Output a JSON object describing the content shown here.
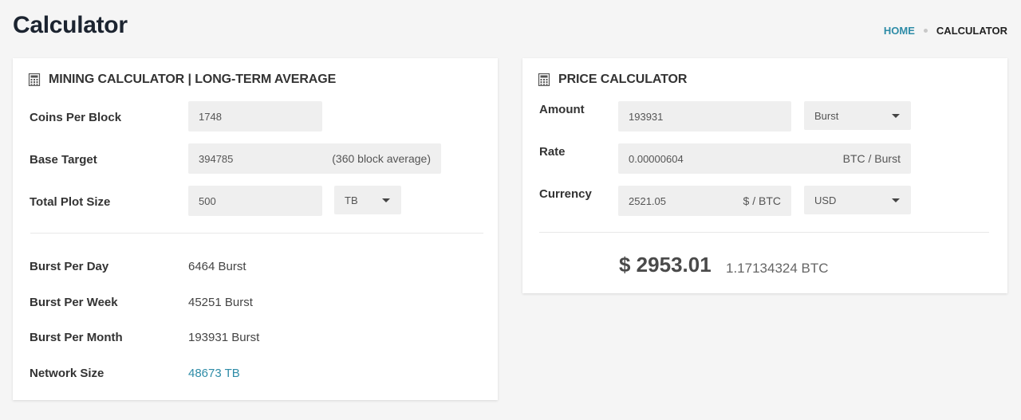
{
  "page": {
    "title": "Calculator"
  },
  "breadcrumb": {
    "home": "HOME",
    "current": "CALCULATOR"
  },
  "mining": {
    "title": "MINING CALCULATOR | LONG-TERM AVERAGE",
    "icon": "calculator-icon",
    "coins_per_block_label": "Coins Per Block",
    "coins_per_block_value": "1748",
    "base_target_label": "Base Target",
    "base_target_value": "394785",
    "base_target_suffix": "(360 block average)",
    "plot_size_label": "Total Plot Size",
    "plot_size_value": "500",
    "plot_unit": "TB",
    "burst_day_label": "Burst Per Day",
    "burst_day_value": "6464 Burst",
    "burst_week_label": "Burst Per Week",
    "burst_week_value": "45251 Burst",
    "burst_month_label": "Burst Per Month",
    "burst_month_value": "193931 Burst",
    "network_size_label": "Network Size",
    "network_size_value": "48673 TB"
  },
  "price": {
    "title": "PRICE CALCULATOR",
    "icon": "calculator-icon",
    "amount_label": "Amount",
    "amount_value": "193931",
    "amount_unit": "Burst",
    "rate_label": "Rate",
    "rate_value": "0.00000604",
    "rate_suffix": "BTC / Burst",
    "currency_label": "Currency",
    "currency_value": "2521.05",
    "currency_suffix": "$ / BTC",
    "currency_unit": "USD",
    "total_usd": "$ 2953.01",
    "total_btc": "1.17134324 BTC"
  },
  "colors": {
    "accent": "#2e8ca7",
    "background": "#f5f5f5",
    "panel": "#ffffff",
    "input": "#efefef"
  }
}
